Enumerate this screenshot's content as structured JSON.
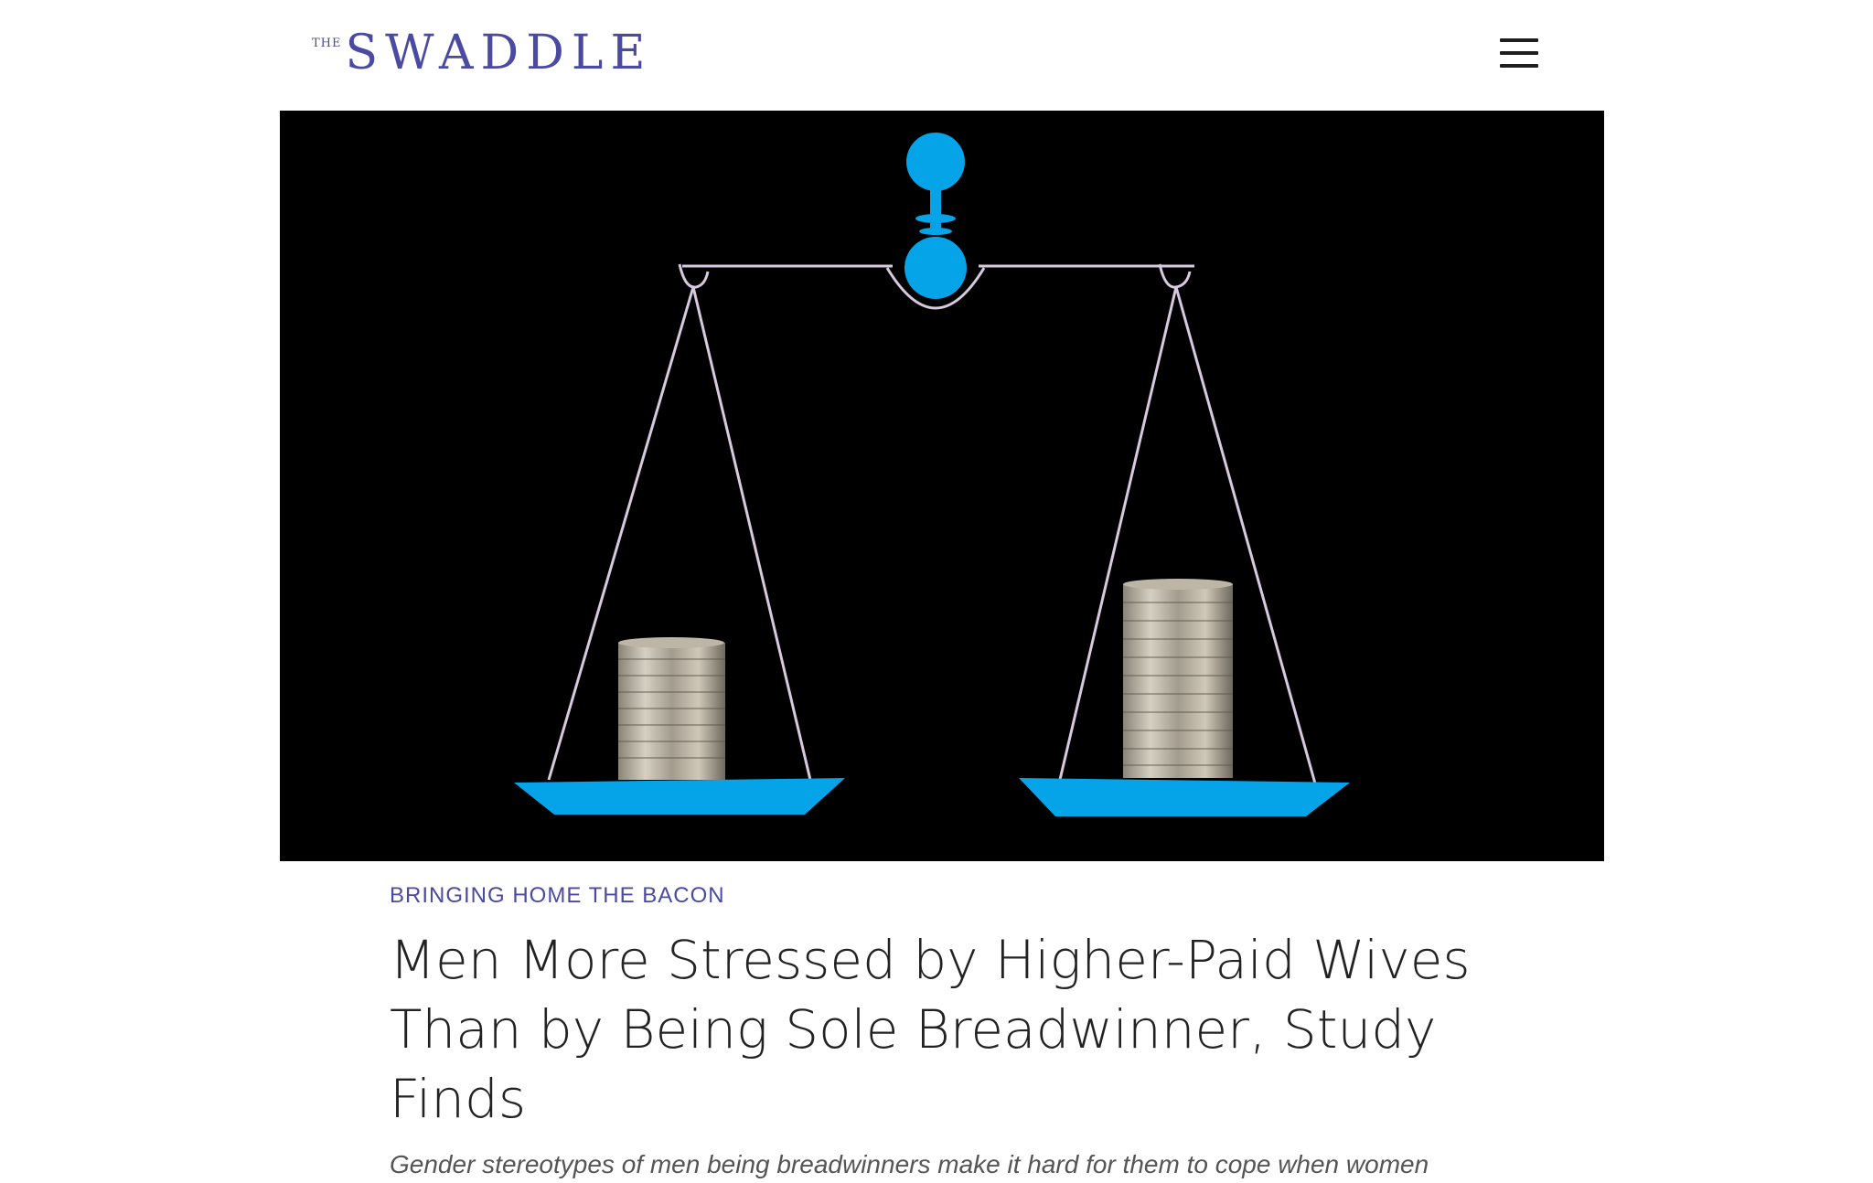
{
  "header": {
    "logo_prefix": "THE",
    "logo_name": "SWADDLE",
    "menu_icon": "hamburger-menu-icon"
  },
  "hero": {
    "image_subject": "balance scale with two coin stacks, right stack taller",
    "colors": {
      "background": "#000000",
      "scale_accent": "#05a3e8",
      "strings": "#d8c8e0"
    }
  },
  "article": {
    "category": "BRINGING HOME THE BACON",
    "title": "Men More Stressed by Higher-Paid Wives Than by Being Sole Breadwinner, Study Finds",
    "excerpt": "Gender stereotypes of men being breadwinners make it hard for them to cope when women"
  },
  "colors": {
    "brand": "#4a4aa3",
    "title_text": "#222222",
    "excerpt_text": "#555555"
  }
}
